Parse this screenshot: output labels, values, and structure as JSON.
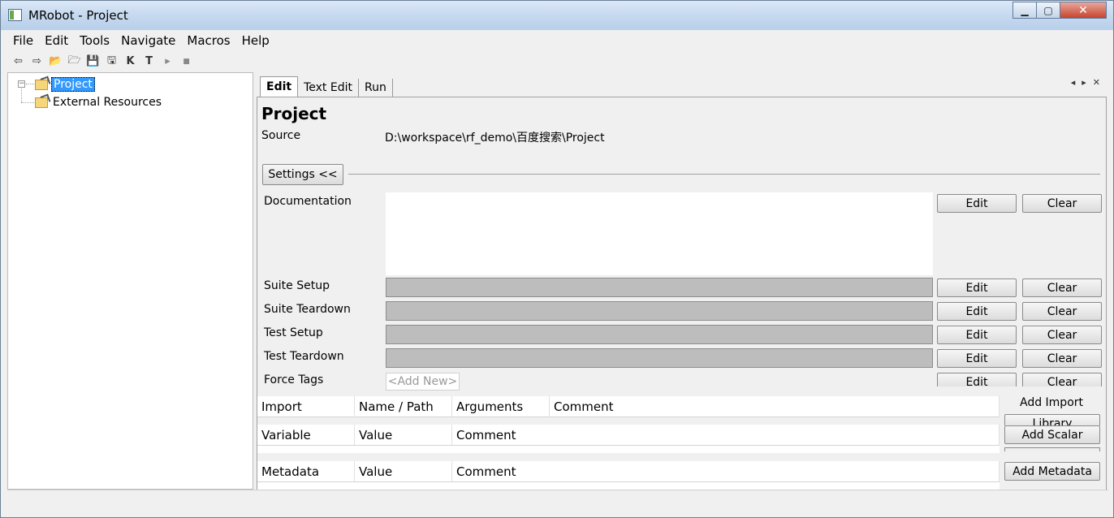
{
  "window": {
    "title": "MRobot - Project",
    "minimize_icon": "minimize-icon",
    "maximize_icon": "maximize-icon",
    "close_icon": "close-icon"
  },
  "menu": [
    "File",
    "Edit",
    "Tools",
    "Navigate",
    "Macros",
    "Help"
  ],
  "toolbar": {
    "icons": [
      "back-arrow-icon",
      "forward-arrow-icon",
      "open-folder-icon",
      "open-directory-icon",
      "save-icon",
      "save-all-icon",
      "keyword-search-icon",
      "text-search-icon",
      "run-icon",
      "stop-icon"
    ],
    "glyphs": [
      "⇦",
      "⇨",
      "📂",
      "🗁",
      "💾",
      "🖫",
      "K",
      "T",
      "▸",
      "■"
    ]
  },
  "tree": {
    "items": [
      {
        "label": "Project",
        "selected": true,
        "icon": "project-folder-icon"
      },
      {
        "label": "External Resources",
        "selected": false,
        "icon": "resources-folder-icon"
      }
    ],
    "expander": "−"
  },
  "tabs": [
    {
      "label": "Edit",
      "active": true
    },
    {
      "label": "Text Edit",
      "active": false
    },
    {
      "label": "Run",
      "active": false
    }
  ],
  "tab_nav": {
    "prev": "◂",
    "next": "▸",
    "close": "✕"
  },
  "editor": {
    "heading": "Project",
    "source_label": "Source",
    "source_value": "D:\\workspace\\rf_demo\\百度搜索\\Project",
    "settings_button": "Settings <<",
    "settings": [
      {
        "label": "Documentation",
        "edit": "Edit",
        "clear": "Clear"
      },
      {
        "label": "Suite Setup",
        "edit": "Edit",
        "clear": "Clear"
      },
      {
        "label": "Suite Teardown",
        "edit": "Edit",
        "clear": "Clear"
      },
      {
        "label": "Test Setup",
        "edit": "Edit",
        "clear": "Clear"
      },
      {
        "label": "Test Teardown",
        "edit": "Edit",
        "clear": "Clear"
      },
      {
        "label": "Force Tags",
        "edit": "Edit",
        "clear": "Clear"
      }
    ],
    "force_tags_placeholder": "<Add New>"
  },
  "import_table": {
    "columns": [
      "Import",
      "Name / Path",
      "Arguments",
      "Comment"
    ],
    "add_import_label": "Add Import",
    "library_button": "Library"
  },
  "variable_table": {
    "columns": [
      "Variable",
      "Value",
      "Comment"
    ],
    "add_scalar_button": "Add Scalar"
  },
  "metadata_table": {
    "columns": [
      "Metadata",
      "Value",
      "Comment"
    ],
    "add_metadata_button": "Add Metadata"
  }
}
